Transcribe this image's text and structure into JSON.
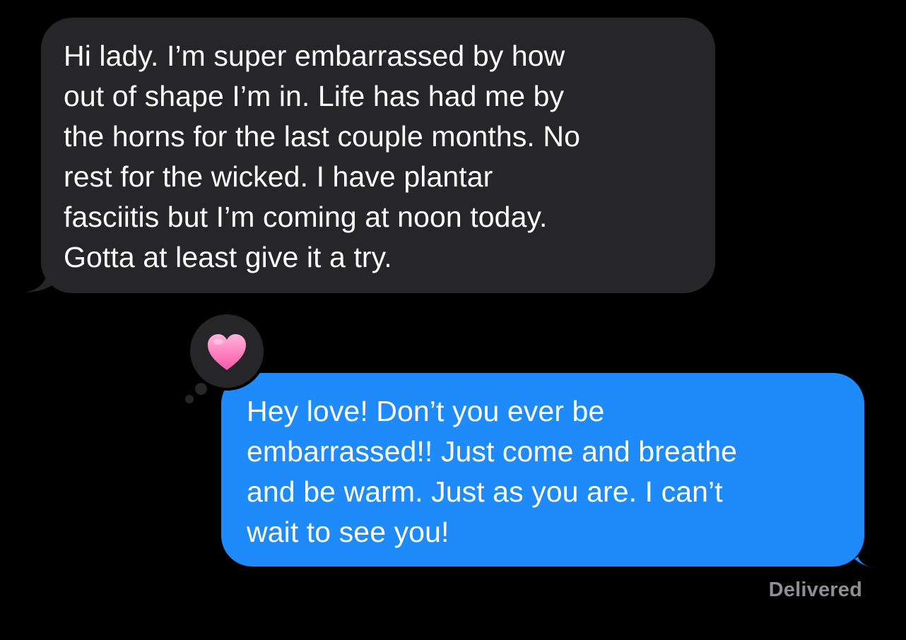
{
  "conversation": {
    "incoming_message": {
      "lines": [
        "Hi lady. I’m super embarrassed by how",
        "out of shape I’m in. Life has had me by",
        "the horns for the last couple months. No",
        "rest for the wicked. I have plantar",
        "fasciitis but I’m coming at noon today.",
        "Gotta at least give it a try."
      ]
    },
    "outgoing_message": {
      "lines": [
        "Hey love! Don’t you ever be",
        "embarrassed!! Just come and breathe",
        "and be warm. Just as you are. I can’t",
        "wait to see you!"
      ],
      "reaction": "heart-icon"
    },
    "status": "Delivered"
  },
  "colors": {
    "background": "#000000",
    "incoming_bubble": "#262629",
    "outgoing_bubble": "#1f8af9",
    "status_text": "#8e8e93",
    "heart": "#ff7fbf"
  }
}
